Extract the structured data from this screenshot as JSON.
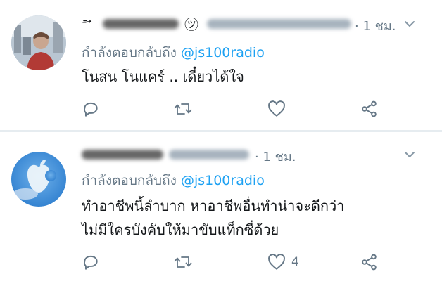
{
  "tweets": [
    {
      "time": "· 1 ชม.",
      "reply_prefix": "กำลังตอบกลับถึง",
      "reply_mention": "@js100radio",
      "text_lines": [
        "โนสน โนแคร์ .. เดี๋ยวได้ใจ"
      ],
      "like_count": ""
    },
    {
      "time": "· 1 ชม.",
      "reply_prefix": "กำลังตอบกลับถึง",
      "reply_mention": "@js100radio",
      "text_lines": [
        "ทำอาชีพนี้ลำบาก หาอาชีพอื่นทำน่าจะดีกว่า",
        "ไม่มีใครบังคับให้มาขับแท็กซี่ด้วย"
      ],
      "like_count": "4"
    }
  ],
  "colors": {
    "mention": "#1da1f2",
    "secondary": "#657786",
    "text": "#14171a",
    "divider": "#e6ecf0"
  },
  "icons": [
    "reply-icon",
    "retweet-icon",
    "like-icon",
    "share-icon",
    "chevron-down-icon"
  ]
}
